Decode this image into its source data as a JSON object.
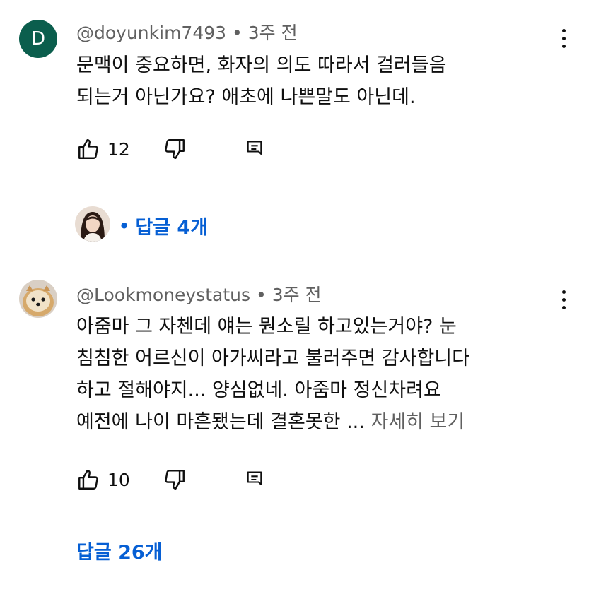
{
  "comments": [
    {
      "avatar_letter": "D",
      "avatar_color": "#0b5e4d",
      "handle": "@doyunkim7493",
      "time": "3주 전",
      "lines": [
        "문맥이 중요하면, 화자의 의도 따라서 걸러들음",
        "되는거 아닌가요? 애초에 나쁜말도 아닌데."
      ],
      "likes": "12",
      "replies": "답글 4개"
    },
    {
      "handle": "@Lookmoneystatus",
      "time": "3주 전",
      "lines": [
        "아줌마 그 자첸데 얘는 뭔소릴 하고있는거야? 눈",
        "침침한 어르신이 아가씨라고 불러주면 감사합니다",
        "하고 절해야지... 양심없네. 아줌마 정신차려요",
        "예전에 나이 마흔됐는데 결혼못한 ..."
      ],
      "more": "자세히 보기",
      "likes": "10",
      "replies": "답글 26개"
    }
  ],
  "icons": {
    "like": "thumbs-up-icon",
    "dislike": "thumbs-down-icon",
    "reply": "reply-icon",
    "menu": "more-vert-icon"
  },
  "colors": {
    "link_blue": "#065fd4",
    "secondary_text": "#606060"
  }
}
